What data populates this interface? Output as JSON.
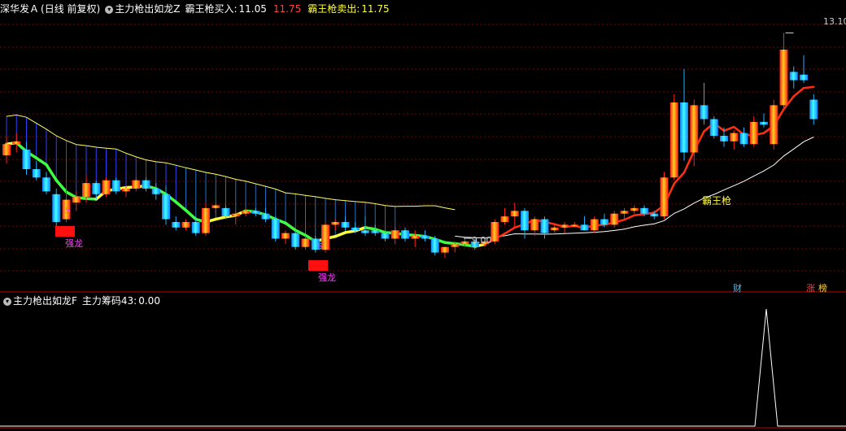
{
  "header": {
    "stock": "深华发Ａ",
    "period": "(日线 前复权)",
    "indicator_main": "主力枪出如龙Z",
    "buy_label": "霸王枪买入:",
    "buy_value": "11.05",
    "buy_value2": "11.75",
    "sell_label": "霸王枪卖出:",
    "sell_value": "11.75"
  },
  "sub_header": {
    "indicator": "主力枪出如龙F",
    "chip_label": "主力筹码43:",
    "chip_value": "0.00"
  },
  "annotations": {
    "high_price": "13.10",
    "low_price": "9.00",
    "dollar": "$",
    "qianglong": "强龙",
    "bawangqiang": "霸王枪",
    "cai": "财",
    "zhang": "涨",
    "bang": "榜"
  },
  "colors": {
    "up": "#ff2020",
    "down": "#20b0ff",
    "yellow_line": "#ffff60",
    "green_line": "#40ff40",
    "red_line": "#ff3010",
    "white_line": "#ffffff",
    "grid": "#800000",
    "sub_line": "#ffffff"
  },
  "chart_data": {
    "type": "candlestick",
    "ylim": [
      8.5,
      13.4
    ],
    "candles": [
      [
        10.9,
        11.25,
        10.75,
        11.1
      ],
      [
        11.1,
        11.3,
        10.95,
        11.15
      ],
      [
        11.0,
        11.15,
        10.55,
        10.65
      ],
      [
        10.65,
        10.8,
        10.45,
        10.5
      ],
      [
        10.5,
        10.6,
        10.2,
        10.25
      ],
      [
        10.2,
        10.3,
        9.6,
        9.7
      ],
      [
        9.75,
        10.3,
        9.7,
        10.1
      ],
      [
        10.05,
        10.25,
        9.9,
        10.15
      ],
      [
        10.15,
        10.55,
        10.05,
        10.4
      ],
      [
        10.4,
        10.45,
        10.1,
        10.2
      ],
      [
        10.2,
        10.5,
        10.15,
        10.45
      ],
      [
        10.45,
        10.5,
        10.2,
        10.25
      ],
      [
        10.25,
        10.35,
        10.15,
        10.3
      ],
      [
        10.3,
        10.5,
        10.25,
        10.45
      ],
      [
        10.45,
        10.5,
        10.25,
        10.3
      ],
      [
        10.3,
        10.4,
        10.1,
        10.2
      ],
      [
        10.2,
        10.35,
        9.65,
        9.75
      ],
      [
        9.7,
        9.8,
        9.55,
        9.6
      ],
      [
        9.6,
        9.75,
        9.55,
        9.7
      ],
      [
        9.7,
        9.75,
        9.45,
        9.5
      ],
      [
        9.5,
        10.05,
        9.45,
        9.95
      ],
      [
        9.95,
        10.05,
        9.85,
        10.0
      ],
      [
        9.95,
        10.0,
        9.75,
        9.8
      ],
      [
        9.8,
        9.9,
        9.65,
        9.85
      ],
      [
        9.85,
        9.95,
        9.8,
        9.9
      ],
      [
        9.9,
        9.95,
        9.8,
        9.85
      ],
      [
        9.85,
        9.95,
        9.7,
        9.75
      ],
      [
        9.75,
        9.8,
        9.35,
        9.4
      ],
      [
        9.4,
        9.55,
        9.3,
        9.5
      ],
      [
        9.5,
        9.55,
        9.2,
        9.25
      ],
      [
        9.25,
        9.45,
        9.2,
        9.4
      ],
      [
        9.4,
        9.45,
        9.15,
        9.2
      ],
      [
        9.2,
        9.7,
        9.15,
        9.65
      ],
      [
        9.65,
        9.75,
        9.55,
        9.7
      ],
      [
        9.7,
        9.8,
        9.55,
        9.6
      ],
      [
        9.6,
        9.7,
        9.5,
        9.55
      ],
      [
        9.55,
        9.8,
        9.45,
        9.5
      ],
      [
        9.55,
        9.65,
        9.45,
        9.5
      ],
      [
        9.5,
        9.55,
        9.35,
        9.4
      ],
      [
        9.4,
        9.6,
        9.3,
        9.55
      ],
      [
        9.55,
        9.6,
        9.35,
        9.4
      ],
      [
        9.4,
        9.55,
        9.25,
        9.45
      ],
      [
        9.45,
        9.55,
        9.35,
        9.4
      ],
      [
        9.4,
        9.45,
        9.1,
        9.15
      ],
      [
        9.15,
        9.25,
        9.05,
        9.25
      ],
      [
        9.25,
        9.35,
        9.15,
        9.3
      ],
      [
        9.3,
        9.4,
        9.25,
        9.35
      ],
      [
        9.35,
        9.4,
        9.2,
        9.25
      ],
      [
        9.3,
        9.4,
        9.25,
        9.35
      ],
      [
        9.35,
        9.75,
        9.3,
        9.7
      ],
      [
        9.7,
        9.95,
        9.65,
        9.8
      ],
      [
        9.8,
        10.05,
        9.6,
        9.9
      ],
      [
        9.9,
        9.95,
        9.4,
        9.55
      ],
      [
        9.55,
        9.8,
        9.45,
        9.75
      ],
      [
        9.75,
        9.8,
        9.4,
        9.5
      ],
      [
        9.55,
        9.65,
        9.5,
        9.6
      ],
      [
        9.6,
        9.7,
        9.5,
        9.65
      ],
      [
        9.65,
        9.7,
        9.6,
        9.65
      ],
      [
        9.65,
        9.8,
        9.55,
        9.55
      ],
      [
        9.55,
        9.8,
        9.5,
        9.75
      ],
      [
        9.75,
        9.85,
        9.6,
        9.65
      ],
      [
        9.65,
        9.9,
        9.6,
        9.85
      ],
      [
        9.85,
        9.95,
        9.75,
        9.9
      ],
      [
        9.9,
        10.0,
        9.85,
        9.95
      ],
      [
        9.95,
        10.0,
        9.8,
        9.85
      ],
      [
        9.85,
        9.9,
        9.75,
        9.8
      ],
      [
        9.8,
        10.6,
        9.75,
        10.5
      ],
      [
        10.5,
        12.0,
        10.45,
        11.85
      ],
      [
        11.85,
        12.45,
        10.8,
        10.95
      ],
      [
        10.95,
        11.9,
        10.7,
        11.8
      ],
      [
        11.8,
        12.2,
        11.45,
        11.55
      ],
      [
        11.55,
        11.6,
        11.2,
        11.25
      ],
      [
        11.25,
        11.4,
        11.05,
        11.15
      ],
      [
        11.15,
        11.35,
        11.0,
        11.3
      ],
      [
        11.3,
        11.4,
        11.05,
        11.1
      ],
      [
        11.1,
        11.6,
        11.05,
        11.5
      ],
      [
        11.5,
        11.65,
        11.4,
        11.45
      ],
      [
        11.1,
        11.9,
        11.0,
        11.8
      ],
      [
        11.8,
        13.1,
        11.7,
        12.8
      ],
      [
        12.4,
        12.5,
        12.1,
        12.25
      ],
      [
        12.35,
        12.7,
        12.2,
        12.25
      ],
      [
        11.9,
        12.0,
        11.45,
        11.55
      ]
    ],
    "sub_series": {
      "name": "主力筹码43",
      "ylim": [
        0,
        100
      ],
      "spike_index": 76,
      "spike_value": 100
    }
  }
}
